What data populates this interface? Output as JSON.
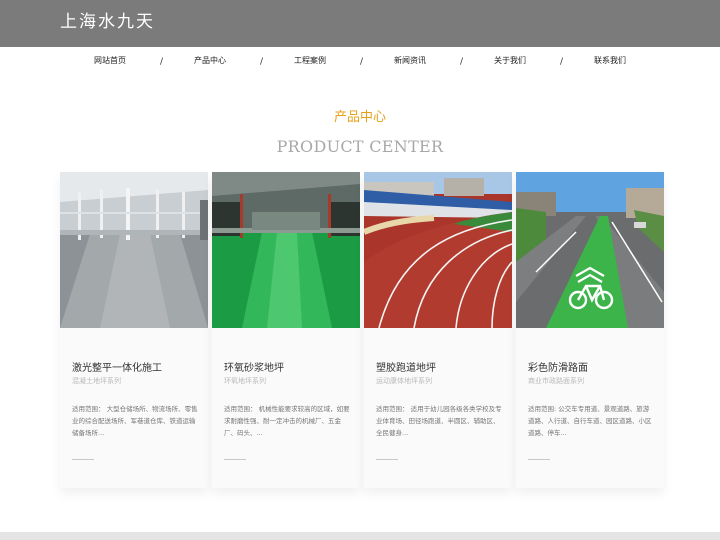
{
  "header": {
    "logo": "上海水九天",
    "bg_color": "#7b7b7b"
  },
  "nav": {
    "items": [
      "网站首页",
      "产品中心",
      "工程案例",
      "新闻资讯",
      "关于我们",
      "联系我们"
    ],
    "separator": "/"
  },
  "section": {
    "title": "产品中心",
    "subtitle": "PRODUCT CENTER",
    "accent_color": "#e4a21a"
  },
  "products": [
    {
      "title": "激光整平一体化施工",
      "subtitle": "混凝土地坪系列",
      "desc": "适用范围： 大型仓储场所、物流场所、零售业的综合配送场所、军巷道仓库、铁道运输储备场所...",
      "image_icon": "warehouse-floor-photo"
    },
    {
      "title": "环氧砂浆地坪",
      "subtitle": "环氧地坪系列",
      "desc": "适用范围： 机械性能要求较高的区域，如要求耐磨性强、耐一定冲击的机械厂、五金厂、码头、...",
      "image_icon": "green-epoxy-factory-photo"
    },
    {
      "title": "塑胶跑道地坪",
      "subtitle": "运动康体地坪系列",
      "desc": "适用范围： 适用于幼儿园各级各类学校及专业体育场、田径场跑道、半圆区、辅助区、全民健身...",
      "image_icon": "running-track-photo"
    },
    {
      "title": "彩色防滑路面",
      "subtitle": "商业市政路面系列",
      "desc": "适用范围: 公交车专用道、景观道路、旅游道路、人行道、自行车道、园区道路、小区道路、停车...",
      "image_icon": "bike-lane-photo"
    }
  ]
}
